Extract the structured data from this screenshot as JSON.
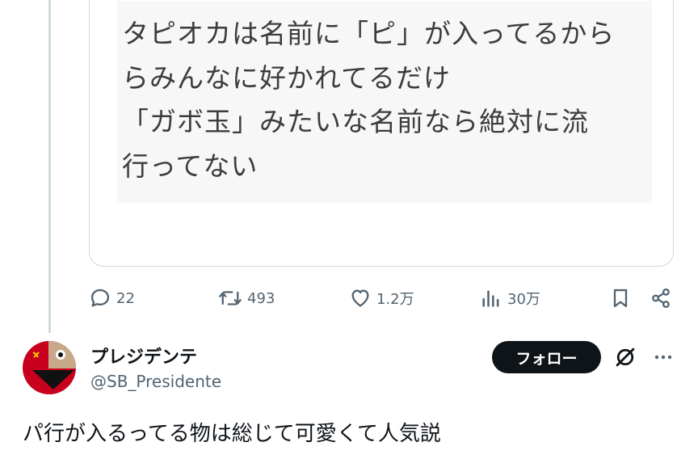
{
  "quote": {
    "text": "タピオカは名前に「ピ」が入ってるから\nらみんなに好かれてるだけ\n「ガボ玉」みたいな名前なら絶対に流\n行ってない"
  },
  "actions": {
    "reply_count": "22",
    "repost_count": "493",
    "like_count": "1.2万",
    "view_count": "30万"
  },
  "user": {
    "display_name": "プレジデンテ",
    "handle": "@SB_Presidente",
    "follow_label": "フォロー"
  },
  "post": {
    "text": "パ行が入るってる物は総じて可愛くて人気説"
  },
  "icons": {
    "reply": "reply-icon",
    "repost": "repost-icon",
    "like": "heart-icon",
    "views": "views-icon",
    "bookmark": "bookmark-icon",
    "share": "share-icon",
    "grok": "grok-icon",
    "more": "more-icon"
  },
  "colors": {
    "muted": "#536471",
    "border": "#cfd9de",
    "follow_bg": "#0f1419"
  }
}
